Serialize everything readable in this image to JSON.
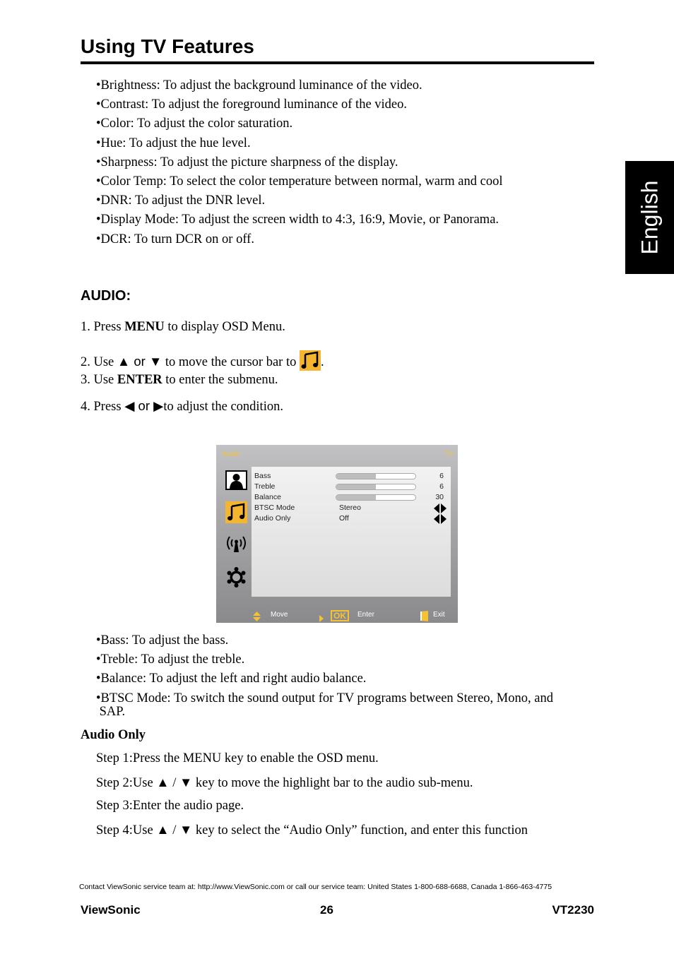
{
  "page": {
    "title": "Using TV Features",
    "language_tab": "English"
  },
  "picture_bullets": [
    "•Brightness: To adjust the background luminance of the video.",
    "•Contrast: To adjust the foreground luminance of the video.",
    "•Color: To adjust the color saturation.",
    "•Hue: To adjust the hue level.",
    "•Sharpness: To adjust the picture sharpness of the display.",
    "•Color Temp: To select the color temperature between normal, warm and cool",
    "•DNR: To adjust the DNR level.",
    "•Display Mode: To adjust the screen width to 4:3, 16:9, Movie, or Panorama.",
    "•DCR: To turn DCR on or off."
  ],
  "audio": {
    "heading": "AUDIO:",
    "steps": {
      "s1_pre": "1. Press ",
      "s1_bold": "MENU",
      "s1_post": " to display OSD Menu.",
      "s2_pre": "2. Use ",
      "s2_up": "▲",
      "s2_or": " or ",
      "s2_down": "▼",
      "s2_post": " to move the cursor bar to ",
      "s2_end": ".",
      "s3_pre": "3. Use ",
      "s3_bold": "ENTER",
      "s3_post": " to enter the submenu.",
      "s4_pre": "4. Press ",
      "s4_left": "◀",
      "s4_or": " or ",
      "s4_right": "▶",
      "s4_post": "to adjust the condition."
    },
    "icon": "music-note-icon"
  },
  "osd": {
    "title_left": "Audio",
    "title_right": "TV",
    "colors": {
      "accent": "#f5c233",
      "icon_bg": "#f6b52e"
    },
    "rows": [
      {
        "label": "Bass",
        "level": 0.5,
        "value": "6"
      },
      {
        "label": "Treble",
        "level": 0.5,
        "value": "6"
      },
      {
        "label": "Balance",
        "level": 0.5,
        "value": "30"
      },
      {
        "label": "BTSC Mode",
        "value": "Stereo"
      },
      {
        "label": "Audio Only",
        "value": "Off"
      }
    ],
    "side_icons": [
      "picture-icon",
      "music-note-icon",
      "antenna-icon",
      "gear-icon"
    ],
    "footer": {
      "move": "Move",
      "ok": "OK",
      "enter": "Enter",
      "exit": "Exit"
    }
  },
  "audio_bullets": [
    "•Bass: To adjust the bass.",
    "•Treble: To adjust the treble.",
    "•Balance: To adjust the left and right audio balance.",
    "•BTSC Mode: To switch the sound output for TV programs between Stereo, Mono, and",
    " SAP."
  ],
  "audio_only": {
    "heading": "Audio Only",
    "steps": [
      "Step 1:Press the MENU key to enable the OSD menu.",
      "Step 2:Use ▲ / ▼ key to move the highlight bar to the audio sub-menu.",
      "Step 3:Enter the audio page.",
      "Step 4:Use ▲ / ▼ key to select the “Audio Only” function, and enter this function"
    ]
  },
  "footer": {
    "contact": "Contact ViewSonic service team at: http://www.ViewSonic.com or call our service team: United States 1-800-688-6688, Canada 1-866-463-4775",
    "brand": "ViewSonic",
    "page_number": "26",
    "model": "VT2230"
  }
}
